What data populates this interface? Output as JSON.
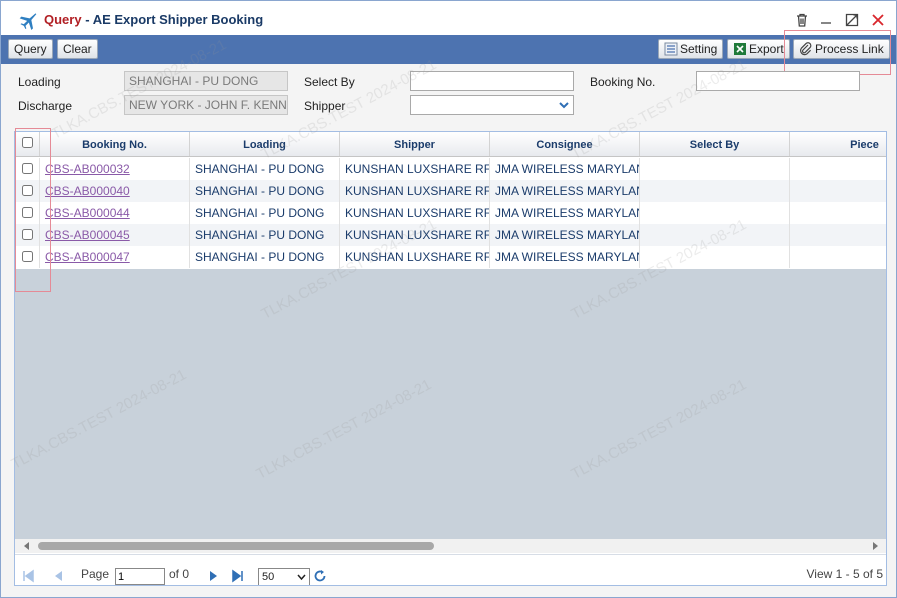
{
  "window": {
    "title_prefix": "Query",
    "title_separator": "-",
    "title_main": "AE Export Shipper Booking"
  },
  "toolbar": {
    "query_label": "Query",
    "clear_label": "Clear",
    "setting_label": "Setting",
    "export_label": "Export",
    "process_link_label": "Process Link"
  },
  "form": {
    "loading_label": "Loading",
    "loading_value": "SHANGHAI - PU DONG",
    "discharge_label": "Discharge",
    "discharge_value": "NEW YORK - JOHN F. KENNEDY",
    "select_by_label": "Select By",
    "select_by_value": "",
    "shipper_label": "Shipper",
    "shipper_value": "",
    "booking_no_label": "Booking No.",
    "booking_no_value": ""
  },
  "grid": {
    "columns": [
      "Booking No.",
      "Loading",
      "Shipper",
      "Consignee",
      "Select By",
      "Piece"
    ],
    "rows": [
      {
        "booking_no": "CBS-AB000032",
        "loading": "SHANGHAI - PU DONG",
        "shipper": "KUNSHAN LUXSHARE RF",
        "consignee": "JMA WIRELESS MARYLAND",
        "select_by": "",
        "piece": ""
      },
      {
        "booking_no": "CBS-AB000040",
        "loading": "SHANGHAI - PU DONG",
        "shipper": "KUNSHAN LUXSHARE RF",
        "consignee": "JMA WIRELESS MARYLAND",
        "select_by": "",
        "piece": ""
      },
      {
        "booking_no": "CBS-AB000044",
        "loading": "SHANGHAI - PU DONG",
        "shipper": "KUNSHAN LUXSHARE RF",
        "consignee": "JMA WIRELESS MARYLAND",
        "select_by": "",
        "piece": ""
      },
      {
        "booking_no": "CBS-AB000045",
        "loading": "SHANGHAI - PU DONG",
        "shipper": "KUNSHAN LUXSHARE RF",
        "consignee": "JMA WIRELESS MARYLAND",
        "select_by": "",
        "piece": ""
      },
      {
        "booking_no": "CBS-AB000047",
        "loading": "SHANGHAI - PU DONG",
        "shipper": "KUNSHAN LUXSHARE RF",
        "consignee": "JMA WIRELESS MARYLAND",
        "select_by": "",
        "piece": ""
      }
    ]
  },
  "pager": {
    "page_label": "Page",
    "page_value": "1",
    "of_label": "of 0",
    "page_size": "50",
    "view_info": "View 1 - 5 of 5"
  },
  "watermark": "TLKA.CBS.TEST 2024-08-21",
  "colors": {
    "toolbar_bg": "#4d73b0",
    "title_accent": "#b11f24",
    "title_text": "#1a3a66",
    "link": "#8a5aa8",
    "highlight": "#e58a96",
    "grid_empty_bg": "#c8d1da"
  },
  "icons": {
    "app": "airplane-icon",
    "delete": "trash-icon",
    "minimize": "minimize-icon",
    "maximize": "maximize-icon",
    "close": "close-icon",
    "setting": "setting-icon",
    "export": "excel-icon",
    "process_link": "paperclip-icon",
    "first": "first-page-icon",
    "prev": "prev-page-icon",
    "next": "next-page-icon",
    "last": "last-page-icon",
    "refresh": "refresh-icon"
  }
}
